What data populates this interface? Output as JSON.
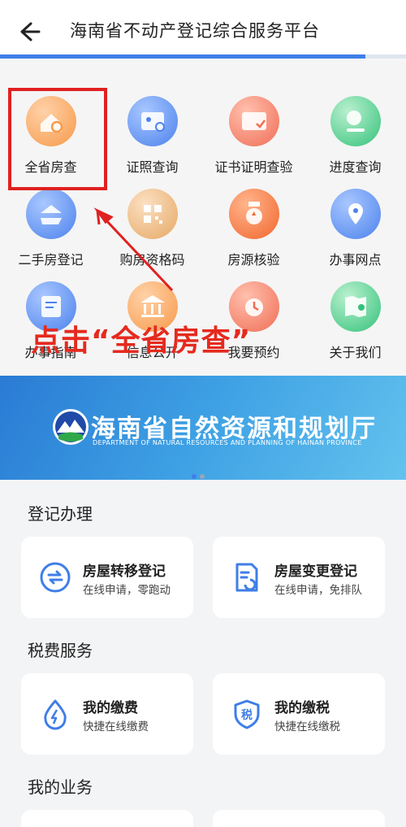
{
  "header": {
    "title": "海南省不动产登记综合服务平台",
    "back_icon": "back-arrow-icon",
    "progress": 0.9
  },
  "grid": [
    {
      "label": "全省房查",
      "icon": "house-search-icon",
      "color": "orange"
    },
    {
      "label": "证照查询",
      "icon": "id-card-search-icon",
      "color": "blue"
    },
    {
      "label": "证书证明查验",
      "icon": "certificate-check-icon",
      "color": "salmon"
    },
    {
      "label": "进度查询",
      "icon": "magnifier-icon",
      "color": "green"
    },
    {
      "label": "二手房登记",
      "icon": "house-hand-icon",
      "color": "blue"
    },
    {
      "label": "购房资格码",
      "icon": "qr-code-icon",
      "color": "tan"
    },
    {
      "label": "房源核验",
      "icon": "badge-icon",
      "color": "orange2"
    },
    {
      "label": "办事网点",
      "icon": "location-pin-icon",
      "color": "blue"
    },
    {
      "label": "办事指南",
      "icon": "guide-book-icon",
      "color": "blue"
    },
    {
      "label": "信息公开",
      "icon": "government-building-icon",
      "color": "orange"
    },
    {
      "label": "我要预约",
      "icon": "alarm-clock-icon",
      "color": "salmon"
    },
    {
      "label": "关于我们",
      "icon": "map-pin-icon",
      "color": "green"
    }
  ],
  "annotation": {
    "text": "点击“全省房查”",
    "color": "#e52a1e"
  },
  "banner": {
    "title": "海南省自然资源和规划厅",
    "subtitle": "DEPARTMENT OF NATURAL RESOURCES AND PLANNING OF HAINAN PROVINCE"
  },
  "sections": [
    {
      "title": "登记办理",
      "cards": [
        {
          "title": "房屋转移登记",
          "subtitle": "在线申请，零跑动",
          "icon": "transfer-icon"
        },
        {
          "title": "房屋变更登记",
          "subtitle": "在线申请，免排队",
          "icon": "document-change-icon"
        }
      ]
    },
    {
      "title": "税费服务",
      "cards": [
        {
          "title": "我的缴费",
          "subtitle": "快捷在线缴费",
          "icon": "payment-drop-icon"
        },
        {
          "title": "我的缴税",
          "subtitle": "快捷在线缴税",
          "icon": "tax-shield-icon"
        }
      ]
    },
    {
      "title": "我的业务",
      "cards": []
    }
  ],
  "colors": {
    "accent": "#3f7ee8",
    "highlight": "#e02020"
  }
}
